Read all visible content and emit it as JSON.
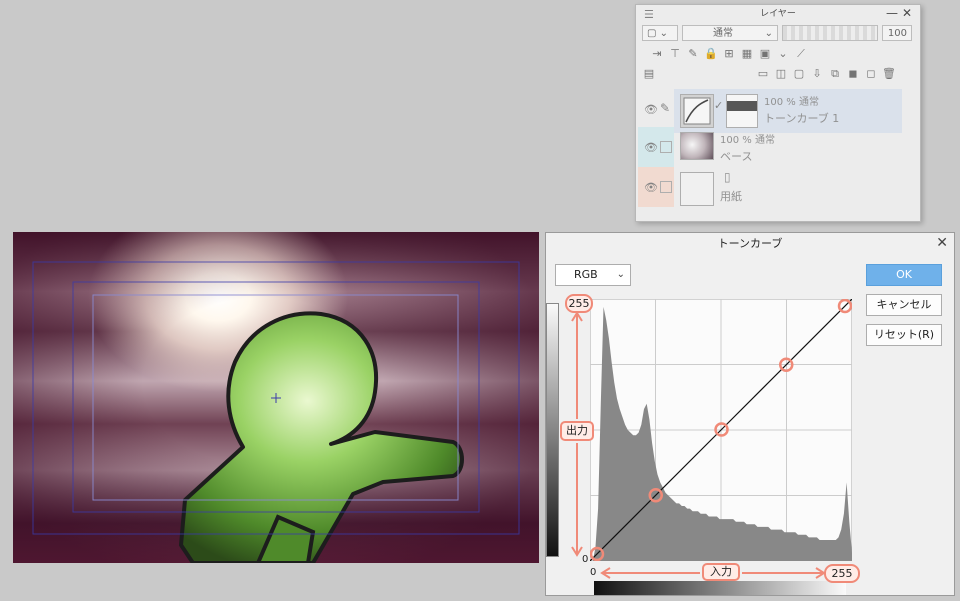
{
  "layer_panel": {
    "title": "レイヤー",
    "blend_mode": "通常",
    "opacity": "100",
    "layers": [
      {
        "opacity_mode": "100 % 通常",
        "name": "トーンカーブ 1",
        "color": "#dde6f2"
      },
      {
        "opacity_mode": "100 % 通常",
        "name": "ベース",
        "color": "#d6eef2"
      },
      {
        "opacity_mode": "",
        "name": "用紙",
        "color": "#f9ded2"
      }
    ]
  },
  "dialog": {
    "title": "トーンカーブ",
    "channel": "RGB",
    "ok_label": "OK",
    "cancel_label": "キャンセル",
    "reset_label": "リセット(R)",
    "output_label": "出力",
    "input_label": "入力",
    "output_max": "255",
    "output_min": "0",
    "input_min": "0",
    "input_max": "255",
    "accent_color": "#6fb1ea",
    "highlight_color": "#f08a78"
  },
  "curve_points": [
    [
      0,
      0
    ],
    [
      64,
      64
    ],
    [
      128,
      128
    ],
    [
      191,
      191
    ],
    [
      255,
      255
    ]
  ],
  "histogram": [
    0,
    0,
    5,
    20,
    60,
    97,
    92,
    85,
    76,
    68,
    62,
    58,
    55,
    52,
    50,
    49,
    48,
    48,
    49,
    52,
    58,
    60,
    54,
    45,
    38,
    33,
    30,
    28,
    26,
    25,
    24,
    23,
    22,
    22,
    21,
    21,
    20,
    20,
    19,
    19,
    19,
    18,
    18,
    18,
    17,
    17,
    17,
    17,
    16,
    16,
    16,
    16,
    16,
    16,
    15,
    15,
    15,
    15,
    14,
    14,
    14,
    14,
    13,
    13,
    13,
    13,
    13,
    12,
    12,
    12,
    12,
    12,
    11,
    11,
    11,
    11,
    11,
    10,
    10,
    10,
    10,
    9,
    9,
    9,
    9,
    8,
    8,
    8,
    8,
    8,
    8,
    8,
    9,
    12,
    18,
    30,
    15,
    3
  ]
}
